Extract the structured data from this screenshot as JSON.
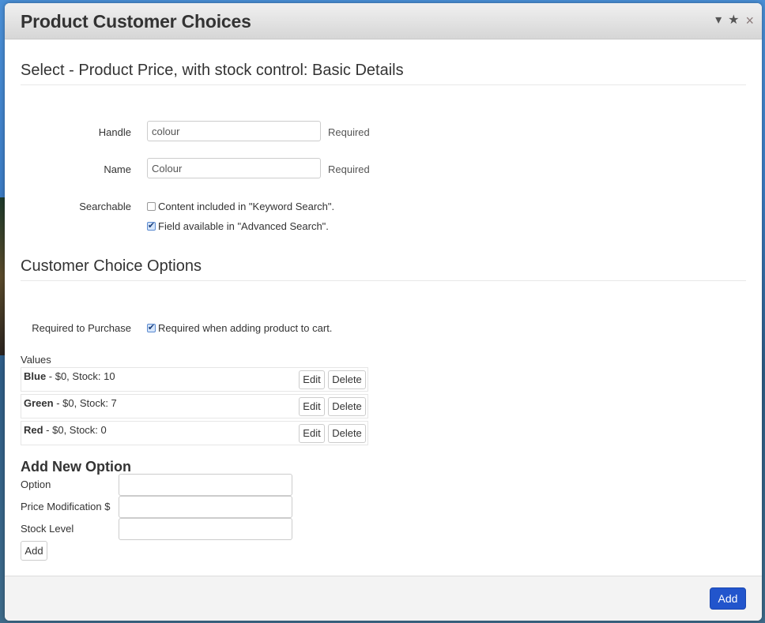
{
  "dialog": {
    "title": "Product Customer Choices",
    "controls": {
      "collapse": "▾",
      "favorite": "★",
      "close": "×"
    }
  },
  "basic": {
    "heading": "Select - Product Price, with stock control: Basic Details",
    "handle": {
      "label": "Handle",
      "value": "colour",
      "hint": "Required"
    },
    "name": {
      "label": "Name",
      "value": "Colour",
      "hint": "Required"
    },
    "searchable": {
      "label": "Searchable",
      "keyword": {
        "label": "Content included in \"Keyword Search\".",
        "checked": false
      },
      "advanced": {
        "label": "Field available in \"Advanced Search\".",
        "checked": true
      }
    }
  },
  "options": {
    "heading": "Customer Choice Options",
    "required": {
      "label": "Required to Purchase",
      "checkbox_label": "Required when adding product to cart.",
      "checked": true
    },
    "values_label": "Values",
    "values": [
      {
        "name": "Blue",
        "detail": " - $0, Stock: 10"
      },
      {
        "name": "Green",
        "detail": " - $0, Stock: 7"
      },
      {
        "name": "Red",
        "detail": " - $0, Stock: 0"
      }
    ],
    "edit_label": "Edit",
    "delete_label": "Delete"
  },
  "add_new": {
    "heading": "Add New Option",
    "option_label": "Option",
    "option_value": "",
    "price_label": "Price Modification $",
    "price_value": "",
    "stock_label": "Stock Level",
    "stock_value": "",
    "add_label": "Add"
  },
  "footer": {
    "add_label": "Add",
    "accent": "#2255cc"
  }
}
